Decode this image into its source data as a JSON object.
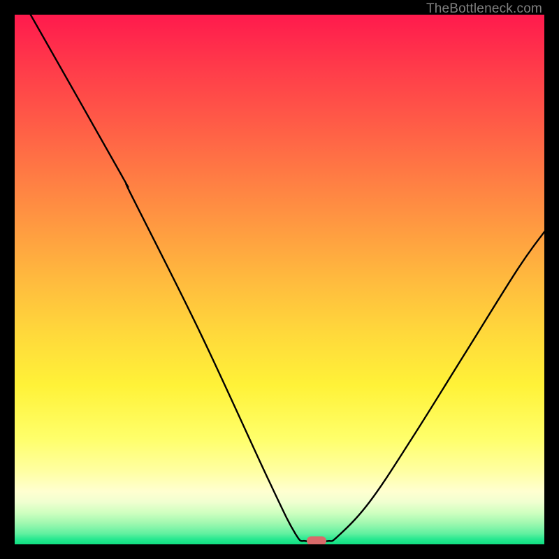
{
  "watermark": "TheBottleneck.com",
  "chart_data": {
    "type": "line",
    "title": "",
    "xlabel": "",
    "ylabel": "",
    "xlim": [
      0,
      100
    ],
    "ylim": [
      0,
      100
    ],
    "curve": [
      {
        "x": 3,
        "y": 100
      },
      {
        "x": 20,
        "y": 70
      },
      {
        "x": 22,
        "y": 66
      },
      {
        "x": 35,
        "y": 40
      },
      {
        "x": 48,
        "y": 12
      },
      {
        "x": 53,
        "y": 2
      },
      {
        "x": 55,
        "y": 0.6
      },
      {
        "x": 59,
        "y": 0.6
      },
      {
        "x": 61,
        "y": 1.5
      },
      {
        "x": 67,
        "y": 8
      },
      {
        "x": 75,
        "y": 20
      },
      {
        "x": 85,
        "y": 36
      },
      {
        "x": 95,
        "y": 52
      },
      {
        "x": 100,
        "y": 59
      }
    ],
    "marker": {
      "x": 57,
      "y": 0.6
    },
    "marker_color": "#d96a6a"
  }
}
